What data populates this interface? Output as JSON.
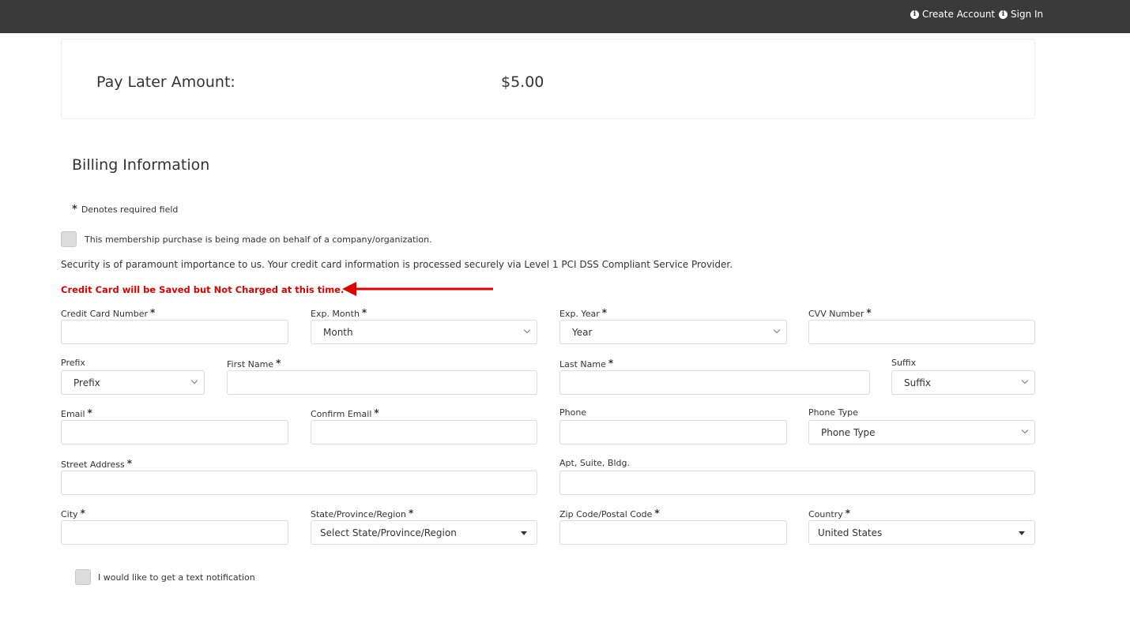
{
  "header": {
    "create_account": "Create Account",
    "sign_in": "Sign In"
  },
  "pay_later": {
    "label": "Pay Later Amount:",
    "amount": "$5.00"
  },
  "billing": {
    "title": "Billing Information",
    "required_note": "Denotes required field",
    "required_star": "*",
    "company_checkbox_label": "This membership purchase is being made on behalf of a company/organization.",
    "security_text": "Security is of paramount importance to us. Your credit card information is processed securely via Level 1 PCI DSS Compliant Service Provider.",
    "warning": "Credit Card will be Saved but Not Charged at this time.",
    "warning_color": "#e00000",
    "text_notification_label": "I would like to get a text notification"
  },
  "fields": {
    "card_number": "Credit Card Number",
    "exp_month": "Exp. Month",
    "exp_year": "Exp. Year",
    "cvv": "CVV Number",
    "prefix": "Prefix",
    "first_name": "First Name",
    "last_name": "Last Name",
    "suffix": "Suffix",
    "email": "Email",
    "confirm_email": "Confirm Email",
    "phone": "Phone",
    "phone_type": "Phone Type",
    "street": "Street Address",
    "apt": "Apt, Suite, Bldg.",
    "city": "City",
    "state": "State/Province/Region",
    "zip": "Zip Code/Postal Code",
    "country": "Country"
  },
  "selects": {
    "month": "Month",
    "year": "Year",
    "prefix": "Prefix",
    "suffix": "Suffix",
    "phone_type": "Phone Type",
    "state": "Select State/Province/Region",
    "country": "United States"
  },
  "icons": {
    "info": "info-circle-icon",
    "arrow": "red-arrow-annotation"
  },
  "colors": {
    "topbar": "#3a3a3a",
    "accent_red": "#e00000"
  }
}
